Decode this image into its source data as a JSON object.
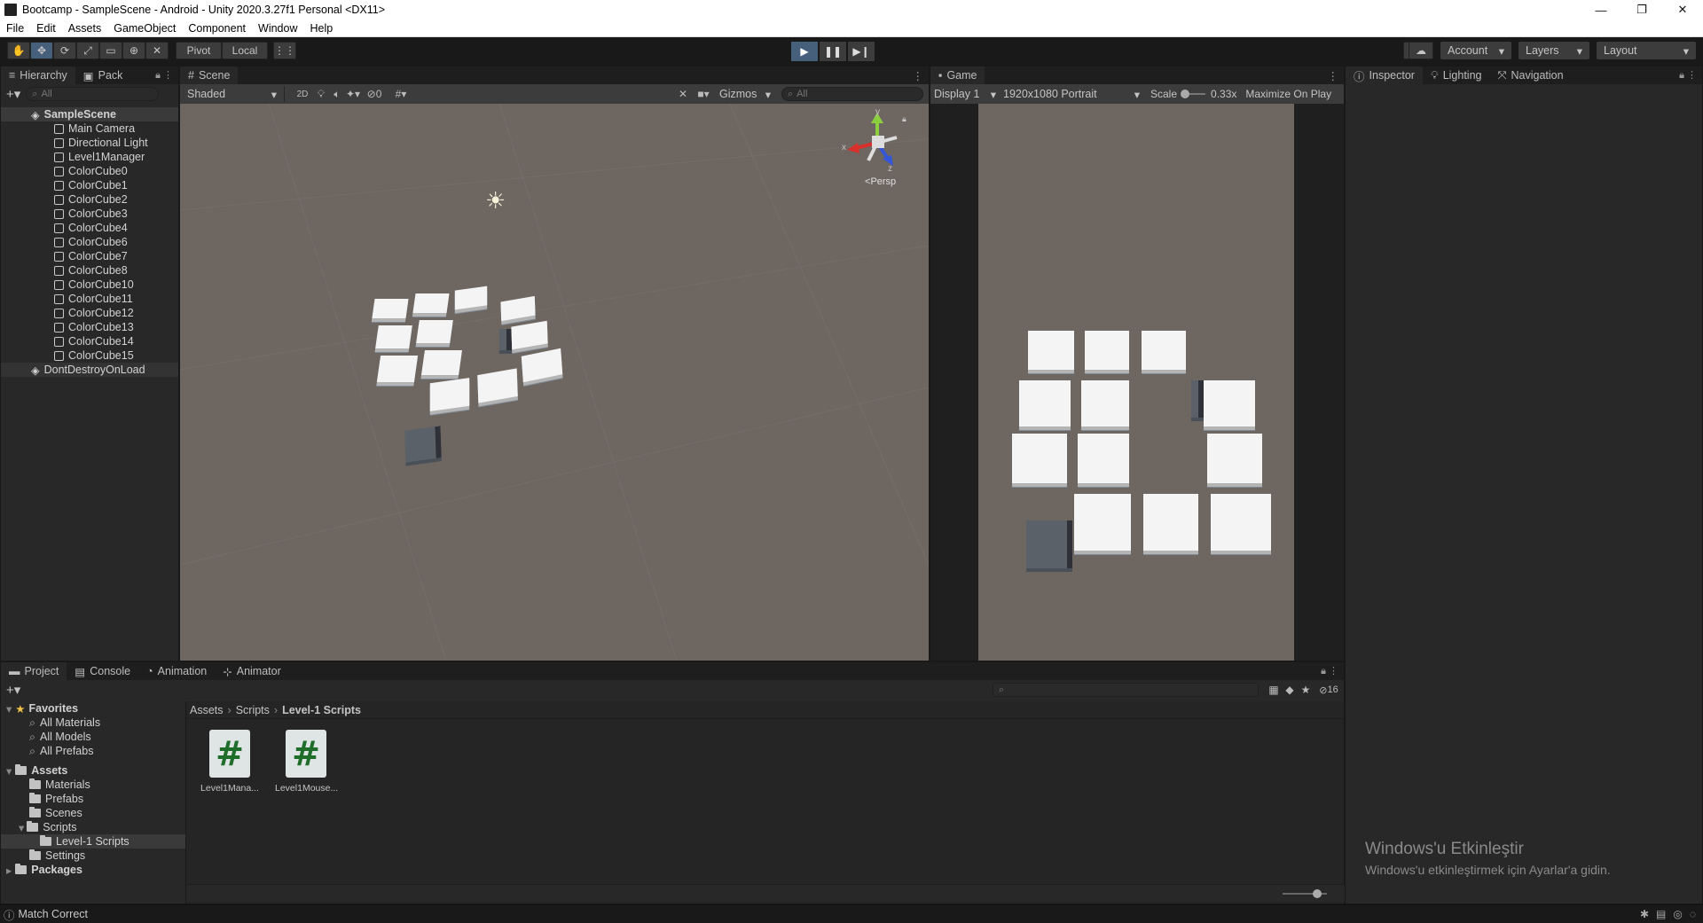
{
  "window": {
    "title": "Bootcamp - SampleScene - Android - Unity 2020.3.27f1 Personal <DX11>",
    "minimize": "—",
    "maximize": "❐",
    "close": "✕"
  },
  "menu": [
    "File",
    "Edit",
    "Assets",
    "GameObject",
    "Component",
    "Window",
    "Help"
  ],
  "toolbar": {
    "pivot": "Pivot",
    "local": "Local",
    "account": "Account",
    "layers": "Layers",
    "layout": "Layout",
    "play_state": "playing"
  },
  "hierarchy": {
    "tabs": [
      "Hierarchy",
      "Pack"
    ],
    "search_placeholder": "All",
    "scene": "SampleScene",
    "items": [
      "Main Camera",
      "Directional Light",
      "Level1Manager",
      "ColorCube0",
      "ColorCube1",
      "ColorCube2",
      "ColorCube3",
      "ColorCube4",
      "ColorCube6",
      "ColorCube7",
      "ColorCube8",
      "ColorCube10",
      "ColorCube11",
      "ColorCube12",
      "ColorCube13",
      "ColorCube14",
      "ColorCube15"
    ],
    "dont_destroy": "DontDestroyOnLoad"
  },
  "scene": {
    "tab": "Scene",
    "shading": "Shaded",
    "mode_2d": "2D",
    "hidden_count": "0",
    "gizmos": "Gizmos",
    "search_placeholder": "All",
    "persp": "Persp",
    "axis_x": "x",
    "axis_y": "y",
    "axis_z": "z"
  },
  "game": {
    "tab": "Game",
    "display": "Display 1",
    "resolution": "1920x1080 Portrait",
    "scale_label": "Scale",
    "scale_value": "0.33x",
    "maximize": "Maximize On Play"
  },
  "inspector": {
    "tabs": [
      "Inspector",
      "Lighting",
      "Navigation"
    ]
  },
  "bottom": {
    "tabs": [
      "Project",
      "Console",
      "Animation",
      "Animator"
    ],
    "hidden_count": "16",
    "favorites_label": "Favorites",
    "favorites": [
      "All Materials",
      "All Models",
      "All Prefabs"
    ],
    "assets_label": "Assets",
    "asset_folders": [
      "Materials",
      "Prefabs",
      "Scenes",
      "Scripts"
    ],
    "scripts_child": "Level-1 Scripts",
    "settings": "Settings",
    "packages": "Packages",
    "breadcrumb": [
      "Assets",
      "Scripts",
      "Level-1 Scripts"
    ],
    "files": [
      "Level1Mana...",
      "Level1Mouse..."
    ]
  },
  "watermark": {
    "title": "Windows'u Etkinleştir",
    "subtitle": "Windows'u etkinleştirmek için Ayarlar'a gidin."
  },
  "status": "Match Correct",
  "colors": {
    "scene_bg": "#6e6661",
    "panel_bg": "#282828",
    "play_active": "#46607c"
  }
}
